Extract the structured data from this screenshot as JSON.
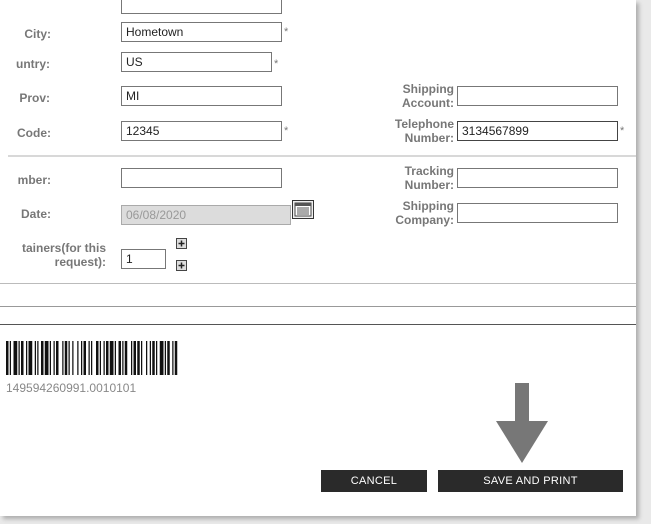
{
  "form": {
    "city": {
      "label": "City:",
      "value": "Hometown"
    },
    "country": {
      "label": "untry:",
      "value": "US"
    },
    "prov": {
      "label": "Prov:",
      "value": "MI"
    },
    "code": {
      "label": "Code:",
      "value": "12345"
    },
    "shipping_account": {
      "label_1": "Shipping",
      "label_2": "Account:",
      "value": ""
    },
    "telephone": {
      "label_1": "Telephone",
      "label_2": "Number:",
      "value": "3134567899"
    },
    "number": {
      "label": "mber:",
      "value": ""
    },
    "tracking": {
      "label_1": "Tracking",
      "label_2": "Number:",
      "value": ""
    },
    "date": {
      "label": "Date:",
      "value": "06/08/2020"
    },
    "shipping_company": {
      "label_1": "Shipping",
      "label_2": "Company:",
      "value": ""
    },
    "containers": {
      "label_1": "tainers(for this",
      "label_2": "request):",
      "value": "1"
    },
    "required_marker": "*"
  },
  "barcode": {
    "number": "149594260991.0010101"
  },
  "buttons": {
    "cancel": "CANCEL",
    "save_print": "SAVE AND PRINT"
  },
  "icons": {
    "calendar": "calendar-icon",
    "increment": "plus-icon",
    "decrement": "minus-icon",
    "arrow": "down-arrow-icon"
  },
  "colors": {
    "button_bg": "#2a2a2a",
    "arrow": "#777777"
  }
}
